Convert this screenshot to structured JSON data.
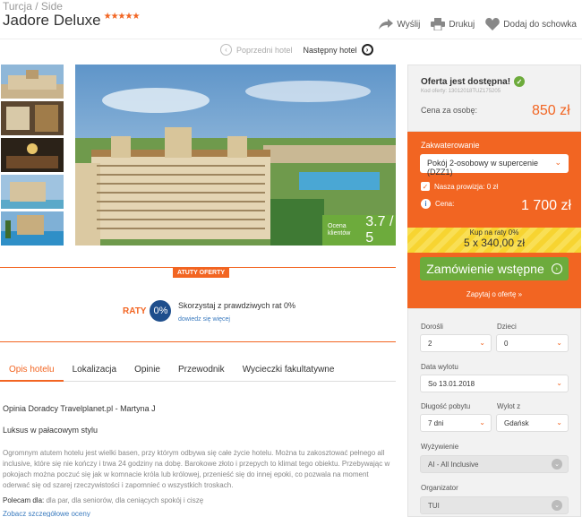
{
  "breadcrumb": "Turcja / Side",
  "hotel": {
    "name": "Jadore Deluxe",
    "stars": "★★★★★"
  },
  "actions": {
    "share": "Wyślij",
    "print": "Drukuj",
    "save": "Dodaj do schowka"
  },
  "hotel_nav": {
    "prev": "Poprzedni hotel",
    "next": "Następny hotel"
  },
  "photo": {
    "rating_label": "Ocena klientów",
    "rating_value": "3.7 / 5"
  },
  "atuty": {
    "tag": "ATUTY OFERTY",
    "raty_word": "RATY",
    "raty_badge": "0%",
    "text": "Skorzystaj z prawdziwych rat 0%",
    "link": "dowiedz się więcej"
  },
  "tabs": [
    {
      "label": "Opis hotelu"
    },
    {
      "label": "Lokalizacja"
    },
    {
      "label": "Opinie"
    },
    {
      "label": "Przewodnik"
    },
    {
      "label": "Wycieczki fakultatywne"
    }
  ],
  "opinion": {
    "title": "Opinia Doradcy Travelplanet.pl - Martyna J",
    "subtitle": "Luksus w pałacowym stylu",
    "text": "Ogromnym atutem hotelu jest wielki basen, przy którym odbywa się całe życie hotelu. Można tu zakosztować pełnego all inclusive, które się nie kończy i trwa 24 godziny na dobę. Barokowe złoto i przepych to klimat tego obiektu. Przebywając w pokojach można poczuć się jak w komnacie króla lub królowej, przenieść się do innej epoki, co pozwala na moment oderwać się od szarej rzeczywistości i zapomnieć o wszystkich troskach.",
    "polecam_label": "Polecam dla:",
    "polecam_value": "dla par, dla seniorów, dla ceniących spokój i ciszę",
    "more": "Zobacz szczegółowe oceny"
  },
  "offer": {
    "available": "Oferta jest dostępna!",
    "code": "Kod oferty: 13012018TUZ175205",
    "price_per_label": "Cena za osobę:",
    "price_per": "850 zł",
    "zakw_label": "Zakwaterowanie",
    "room": "Pokój 2-osobowy w supercenie (DZZ1)",
    "prowizja": "Nasza prowizja: 0 zł",
    "cena_label": "Cena:",
    "cena": "1 700 zł",
    "raty_l1": "Kup na raty 0%",
    "raty_l2": "5 x 340,00 zł",
    "order": "Zamówienie wstępne",
    "ask": "Zapytaj o ofertę »"
  },
  "form": {
    "adults_label": "Dorośli",
    "adults": "2",
    "kids_label": "Dzieci",
    "kids": "0",
    "date_label": "Data wylotu",
    "date": "So 13.01.2018",
    "len_label": "Długość pobytu",
    "len": "7 dni",
    "from_label": "Wylot z",
    "from": "Gdańsk",
    "board_label": "Wyżywienie",
    "board": "AI - All Inclusive",
    "org_label": "Organizator",
    "org": "TUI"
  }
}
